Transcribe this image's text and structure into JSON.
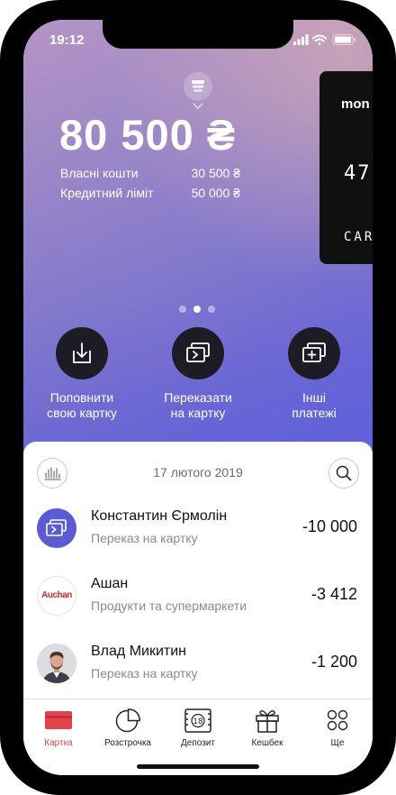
{
  "status_bar": {
    "time": "19:12"
  },
  "balance": {
    "amount": "80 500 ₴"
  },
  "details": [
    {
      "label": "Власні кошти",
      "value": "30 500 ₴"
    },
    {
      "label": "Кредитний ліміт",
      "value": "50 000 ₴"
    }
  ],
  "card": {
    "brand": "mon",
    "number": "47",
    "type": "CAR"
  },
  "pager": {
    "count": 3,
    "active": 1
  },
  "actions": [
    {
      "label": "Поповнити\nсвою картку",
      "icon": "download-tray-icon"
    },
    {
      "label": "Переказати\nна картку",
      "icon": "card-transfer-icon"
    },
    {
      "label": "Інші\nплатежі",
      "icon": "add-card-icon"
    }
  ],
  "feed": {
    "date": "17 лютого 2019",
    "transactions": [
      {
        "name": "Константин Єрмолін",
        "category": "Переказ на картку",
        "amount": "-10 000",
        "avatar": "card-transfer-icon"
      },
      {
        "name": "Ашан",
        "category": "Продукти та супермаркети",
        "amount": "-3 412",
        "avatar": "auchan-logo",
        "logo_text": "Auchan"
      },
      {
        "name": "Влад Микитин",
        "category": "Переказ на картку",
        "amount": "-1 200",
        "avatar": "person-photo"
      }
    ]
  },
  "tabs": [
    {
      "label": "Картка",
      "icon": "card-icon",
      "active": true
    },
    {
      "label": "Розстрочка",
      "icon": "pie-chart-icon",
      "active": false
    },
    {
      "label": "Депозит",
      "icon": "deposit-icon",
      "active": false
    },
    {
      "label": "Кешбек",
      "icon": "gift-icon",
      "active": false
    },
    {
      "label": "Ще",
      "icon": "more-grid-icon",
      "active": false
    }
  ],
  "deposit_icon_text": "18",
  "colors": {
    "accent": "#e5434b",
    "action_circle": "#1d1c25",
    "transfer_avatar": "#5b5bd6"
  }
}
